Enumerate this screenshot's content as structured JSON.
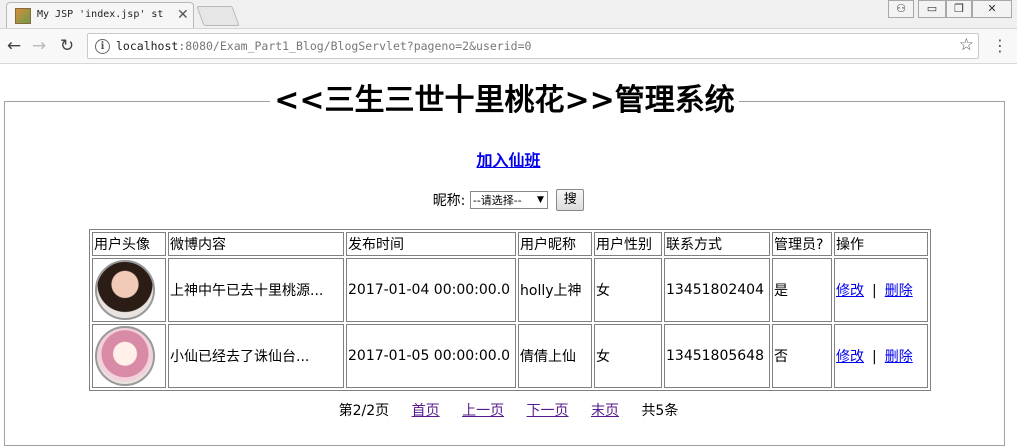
{
  "browser": {
    "tab_title": "My JSP 'index.jsp' st",
    "url_host": "localhost",
    "url_rest": ":8080/Exam_Part1_Blog/BlogServlet?pageno=2&userid=0"
  },
  "page": {
    "heading": "<<三生三世十里桃花>>管理系统",
    "add_link": "加入仙班",
    "search": {
      "label": "昵称:",
      "selected": "--请选择--",
      "button": "搜"
    },
    "table": {
      "headers": [
        "用户头像",
        "微博内容",
        "发布时间",
        "用户昵称",
        "用户性别",
        "联系方式",
        "管理员?",
        "操作"
      ],
      "rows": [
        {
          "content": "上神中午已去十里桃源...",
          "time": "2017-01-04 00:00:00.0",
          "nickname": "holly上神",
          "gender": "女",
          "phone": "13451802404",
          "admin": "是",
          "edit": "修改",
          "sep": "|",
          "delete": "删除"
        },
        {
          "content": "小仙已经去了诛仙台...",
          "time": "2017-01-05 00:00:00.0",
          "nickname": "倩倩上仙",
          "gender": "女",
          "phone": "13451805648",
          "admin": "否",
          "edit": "修改",
          "sep": "|",
          "delete": "删除"
        }
      ]
    },
    "pager": {
      "status": "第2/2页",
      "first": "首页",
      "prev": "上一页",
      "next": "下一页",
      "last": "末页",
      "total": "共5条"
    }
  }
}
